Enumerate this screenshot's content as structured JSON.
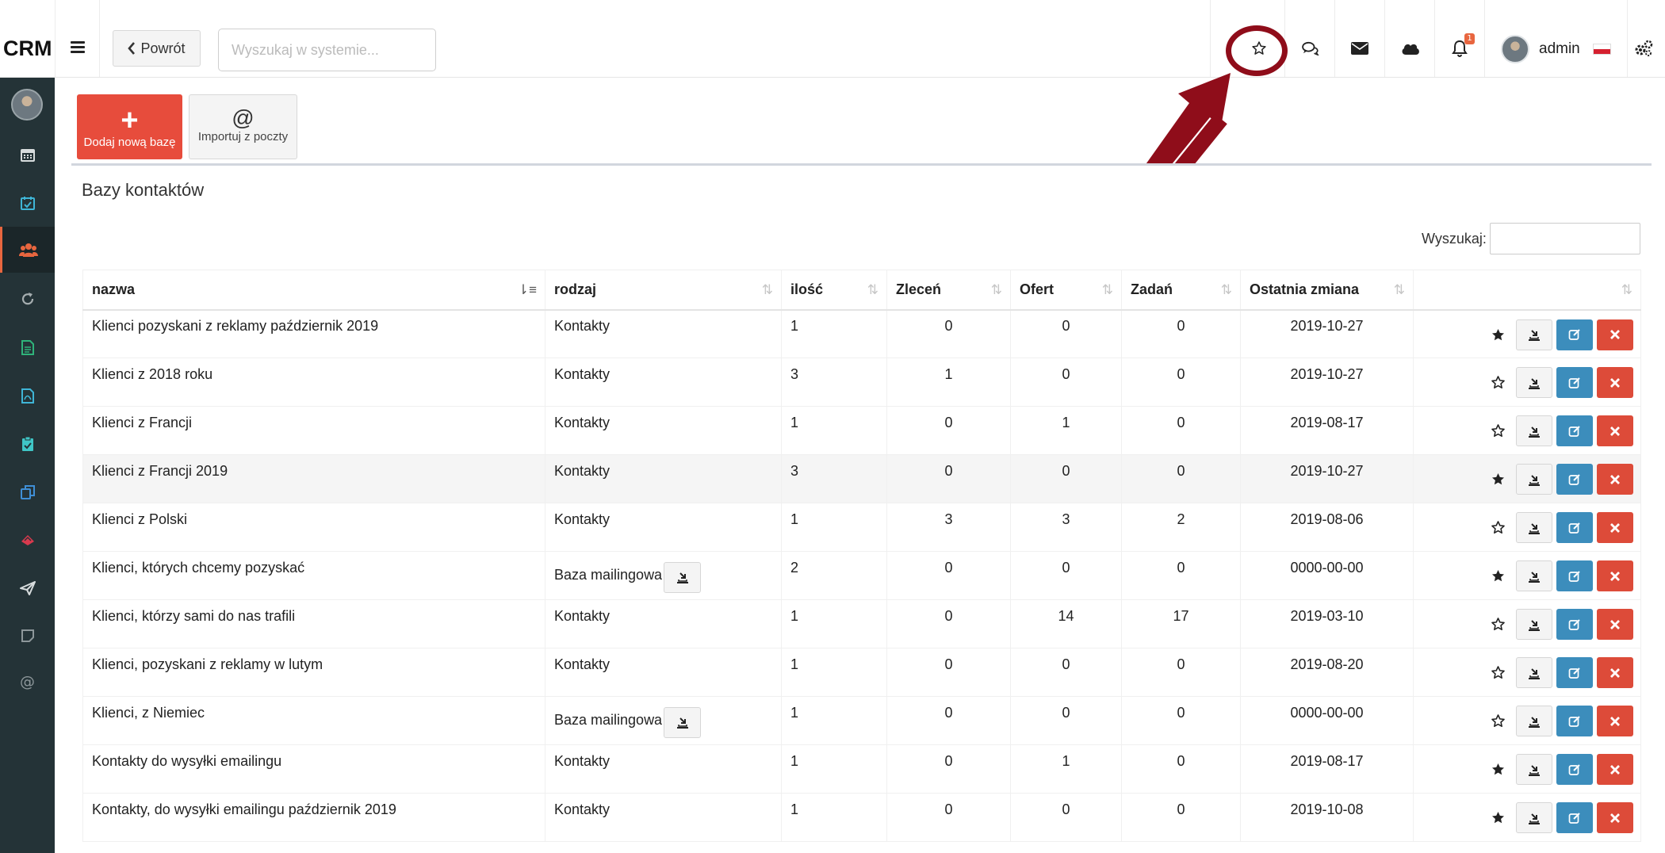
{
  "brand": "CRM",
  "topbar": {
    "back_label": "Powrót",
    "search_placeholder": "Wyszukaj w systemie...",
    "notification_count": "1",
    "user_name": "admin",
    "icons": [
      "bars-icon",
      "chevron-left-icon",
      "star-outline-icon",
      "comments-icon",
      "envelope-icon",
      "cloud-icon",
      "bell-icon",
      "cogs-icon"
    ]
  },
  "sidebar": {
    "icons": [
      "calendar-icon",
      "calendar-check-icon",
      "users-icon",
      "refresh-icon",
      "document-icon",
      "pdf-icon",
      "clipboard-icon",
      "copy-icon",
      "ticket-icon",
      "paper-plane-icon",
      "note-icon",
      "at-icon"
    ],
    "active_index": 2
  },
  "toolbar": {
    "add_label": "Dodaj nową bazę",
    "import_label": "Importuj z poczty"
  },
  "panel": {
    "title": "Bazy kontaktów",
    "search_label": "Wyszukaj:"
  },
  "table": {
    "headers": [
      "nazwa",
      "rodzaj",
      "ilość",
      "Zleceń",
      "Ofert",
      "Zadań",
      "Ostatnia zmiana",
      ""
    ],
    "rows": [
      {
        "name": "Klienci pozyskani z reklamy październik 2019",
        "type": "Kontakty",
        "count": "1",
        "orders": "0",
        "offers": "0",
        "tasks": "0",
        "changed": "2019-10-27",
        "fav": true,
        "mailing": false
      },
      {
        "name": "Klienci z 2018 roku",
        "type": "Kontakty",
        "count": "3",
        "orders": "1",
        "offers": "0",
        "tasks": "0",
        "changed": "2019-10-27",
        "fav": false,
        "mailing": false
      },
      {
        "name": "Klienci z Francji",
        "type": "Kontakty",
        "count": "1",
        "orders": "0",
        "offers": "1",
        "tasks": "0",
        "changed": "2019-08-17",
        "fav": false,
        "mailing": false
      },
      {
        "name": "Klienci z Francji 2019",
        "type": "Kontakty",
        "count": "3",
        "orders": "0",
        "offers": "0",
        "tasks": "0",
        "changed": "2019-10-27",
        "fav": true,
        "mailing": false
      },
      {
        "name": "Klienci z Polski",
        "type": "Kontakty",
        "count": "1",
        "orders": "3",
        "offers": "3",
        "tasks": "2",
        "changed": "2019-08-06",
        "fav": false,
        "mailing": false
      },
      {
        "name": "Klienci, których chcemy pozyskać",
        "type": "Baza mailingowa",
        "count": "2",
        "orders": "0",
        "offers": "0",
        "tasks": "0",
        "changed": "0000-00-00",
        "fav": true,
        "mailing": true
      },
      {
        "name": "Klienci, którzy sami do nas trafili",
        "type": "Kontakty",
        "count": "1",
        "orders": "0",
        "offers": "14",
        "tasks": "17",
        "changed": "2019-03-10",
        "fav": false,
        "mailing": false
      },
      {
        "name": "Klienci, pozyskani z reklamy w lutym",
        "type": "Kontakty",
        "count": "1",
        "orders": "0",
        "offers": "0",
        "tasks": "0",
        "changed": "2019-08-20",
        "fav": false,
        "mailing": false
      },
      {
        "name": "Klienci, z Niemiec",
        "type": "Baza mailingowa",
        "count": "1",
        "orders": "0",
        "offers": "0",
        "tasks": "0",
        "changed": "0000-00-00",
        "fav": false,
        "mailing": true
      },
      {
        "name": "Kontakty do wysyłki emailingu",
        "type": "Kontakty",
        "count": "1",
        "orders": "0",
        "offers": "1",
        "tasks": "0",
        "changed": "2019-08-17",
        "fav": true,
        "mailing": false
      },
      {
        "name": "Kontakty, do wysyłki emailingu październik 2019",
        "type": "Kontakty",
        "count": "1",
        "orders": "0",
        "offers": "0",
        "tasks": "0",
        "changed": "2019-10-08",
        "fav": true,
        "mailing": false
      }
    ],
    "highlight_row": 3
  },
  "colors": {
    "sidebar_bg": "#243337",
    "add_btn": "#e74c3c",
    "edit_btn": "#3c8dbc",
    "delete_btn": "#dd4b39",
    "annotation": "#8f0d1a",
    "badge": "#e8663f"
  }
}
